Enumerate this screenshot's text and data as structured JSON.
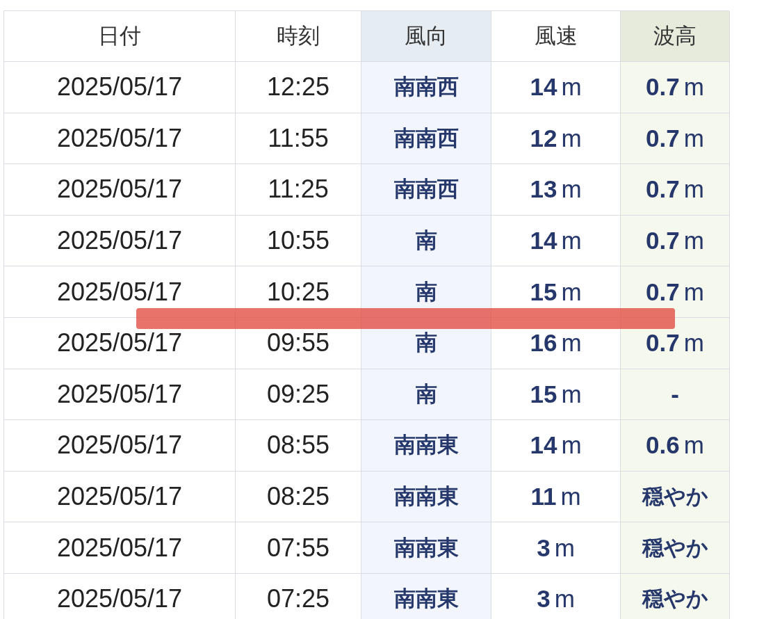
{
  "table": {
    "columns": [
      {
        "label": "日付",
        "kind": "plain"
      },
      {
        "label": "時刻",
        "kind": "plain"
      },
      {
        "label": "風向",
        "kind": "direction"
      },
      {
        "label": "風速",
        "kind": "speed"
      },
      {
        "label": "波高",
        "kind": "wave"
      }
    ],
    "rows": [
      {
        "date": "2025/05/17",
        "time": "12:25",
        "direction": "南南西",
        "speed": {
          "value": "14",
          "unit": "m"
        },
        "wave": {
          "value": "0.7",
          "unit": "m"
        },
        "marked": false
      },
      {
        "date": "2025/05/17",
        "time": "11:55",
        "direction": "南南西",
        "speed": {
          "value": "12",
          "unit": "m"
        },
        "wave": {
          "value": "0.7",
          "unit": "m"
        },
        "marked": false
      },
      {
        "date": "2025/05/17",
        "time": "11:25",
        "direction": "南南西",
        "speed": {
          "value": "13",
          "unit": "m"
        },
        "wave": {
          "value": "0.7",
          "unit": "m"
        },
        "marked": false
      },
      {
        "date": "2025/05/17",
        "time": "10:55",
        "direction": "南",
        "speed": {
          "value": "14",
          "unit": "m"
        },
        "wave": {
          "value": "0.7",
          "unit": "m"
        },
        "marked": false
      },
      {
        "date": "2025/05/17",
        "time": "10:25",
        "direction": "南",
        "speed": {
          "value": "15",
          "unit": "m"
        },
        "wave": {
          "value": "0.7",
          "unit": "m"
        },
        "marked": false
      },
      {
        "date": "2025/05/17",
        "time": "09:55",
        "direction": "南",
        "speed": {
          "value": "16",
          "unit": "m"
        },
        "wave": {
          "value": "0.7",
          "unit": "m"
        },
        "marked": true
      },
      {
        "date": "2025/05/17",
        "time": "09:25",
        "direction": "南",
        "speed": {
          "value": "15",
          "unit": "m"
        },
        "wave": {
          "value": "-"
        },
        "marked": false
      },
      {
        "date": "2025/05/17",
        "time": "08:55",
        "direction": "南南東",
        "speed": {
          "value": "14",
          "unit": "m"
        },
        "wave": {
          "value": "0.6",
          "unit": "m"
        },
        "marked": false
      },
      {
        "date": "2025/05/17",
        "time": "08:25",
        "direction": "南南東",
        "speed": {
          "value": "11",
          "unit": "m"
        },
        "wave": {
          "value": "穏やか"
        },
        "marked": false
      },
      {
        "date": "2025/05/17",
        "time": "07:55",
        "direction": "南南東",
        "speed": {
          "value": "3",
          "unit": "m"
        },
        "wave": {
          "value": "穏やか"
        },
        "marked": false
      },
      {
        "date": "2025/05/17",
        "time": "07:25",
        "direction": "南南東",
        "speed": {
          "value": "3",
          "unit": "m"
        },
        "wave": {
          "value": "穏やか"
        },
        "marked": false
      }
    ]
  }
}
